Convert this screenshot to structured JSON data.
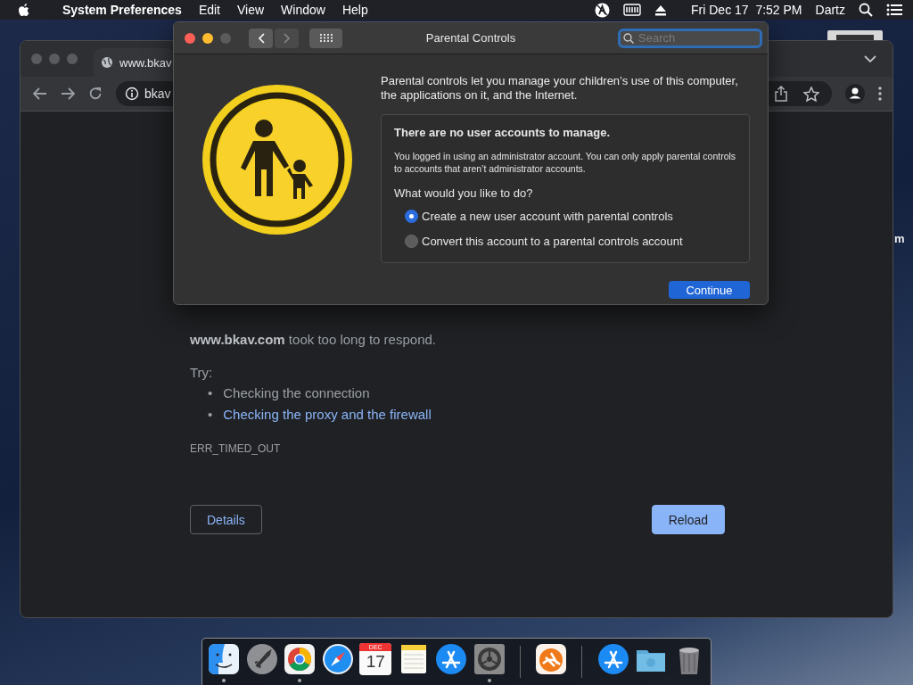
{
  "menu_bar": {
    "app": "System Preferences",
    "menus": [
      "Edit",
      "View",
      "Window",
      "Help"
    ],
    "clock": "Fri Dec 17  7:52 PM",
    "user": "Dartz"
  },
  "desktop": {
    "icon_label": "m"
  },
  "browser": {
    "tab_title": "www.bkav",
    "address": "bkav",
    "error": {
      "message": "**www.bkav.com** took too long to respond.",
      "try_label": "Try:",
      "bullet": "•",
      "suggestions": [
        {
          "text": "Checking the connection",
          "kind": "text"
        },
        {
          "text": "Checking the proxy and the firewall",
          "kind": "link"
        }
      ],
      "code": "ERR_TIMED_OUT",
      "buttons": [
        {
          "label": "Details",
          "kind": "secondary"
        },
        {
          "label": "Reload",
          "kind": "primary"
        }
      ]
    }
  },
  "dialog": {
    "title": "Parental Controls",
    "search": {
      "placeholder": "Search"
    },
    "intro": "Parental controls let you manage your children’s use of this computer, the applications on it, and the Internet.",
    "notice_title": "There are no user accounts to manage.",
    "notice_body": "You logged in using an administrator account. You can only apply parental controls to accounts that aren’t administrator accounts.",
    "question": "What would you like to do?",
    "options": [
      {
        "label": "Create a new user account with parental controls",
        "selected": true
      },
      {
        "label": "Convert this account to a parental controls account",
        "selected": false
      }
    ],
    "button": "Continue"
  },
  "dock": {
    "items": [
      {
        "kind": "finder",
        "running": true
      },
      {
        "kind": "launchpad",
        "running": false
      },
      {
        "kind": "chrome",
        "running": true
      },
      {
        "kind": "safari",
        "running": false
      },
      {
        "kind": "calendar",
        "running": false,
        "month": "DEC",
        "day": "17"
      },
      {
        "kind": "notes",
        "running": false
      },
      {
        "kind": "appstore",
        "running": false
      },
      {
        "kind": "settings",
        "running": true
      },
      {
        "kind": "separator"
      },
      {
        "kind": "sparkle-app",
        "running": false
      },
      {
        "kind": "separator"
      },
      {
        "kind": "appstore",
        "running": false
      },
      {
        "kind": "folder",
        "running": false
      },
      {
        "kind": "trash",
        "running": false
      }
    ]
  }
}
